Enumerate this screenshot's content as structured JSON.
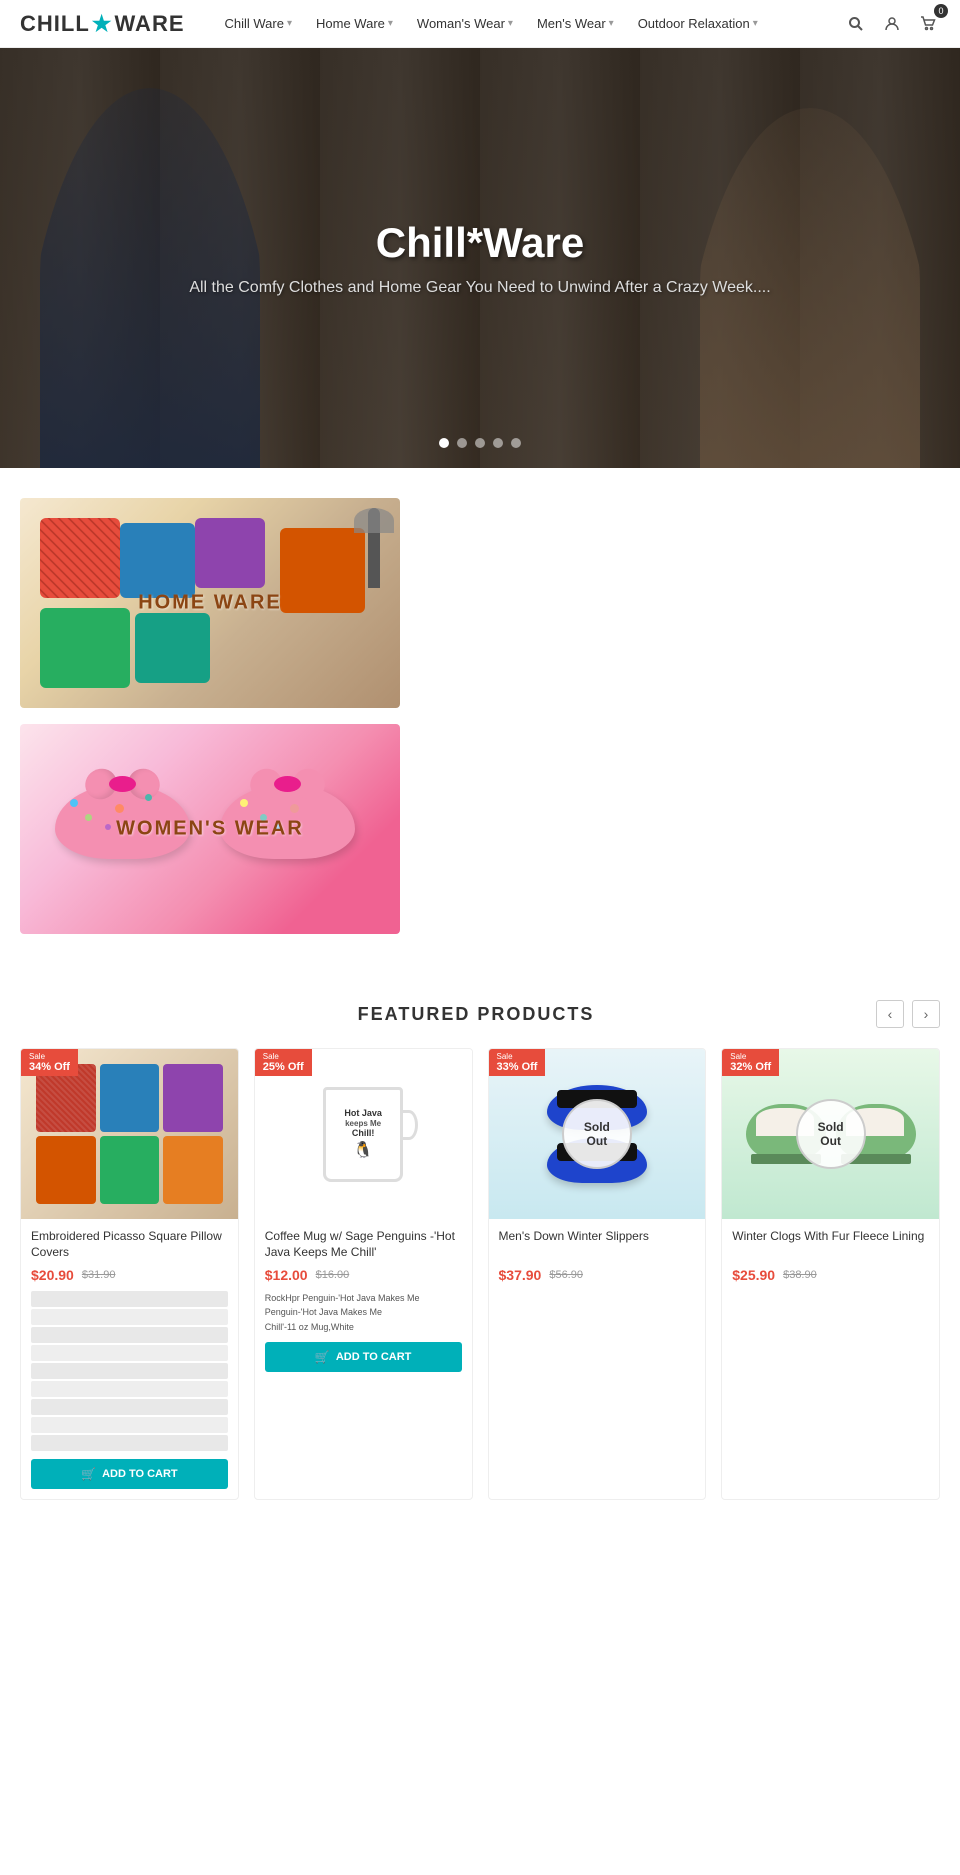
{
  "header": {
    "logo": "CHILL",
    "logo_star": "★",
    "logo_ware": "WARE",
    "nav_items": [
      {
        "label": "Chill Ware",
        "has_dropdown": true
      },
      {
        "label": "Home Ware",
        "has_dropdown": true
      },
      {
        "label": "Woman's Wear",
        "has_dropdown": true
      },
      {
        "label": "Men's Wear",
        "has_dropdown": true
      },
      {
        "label": "Outdoor Relaxation",
        "has_dropdown": true
      }
    ],
    "cart_count": "0"
  },
  "hero": {
    "title": "Chill*Ware",
    "subtitle": "All the Comfy Clothes and Home Gear You Need to Unwind After a Crazy Week....",
    "dots": [
      true,
      false,
      false,
      false,
      false
    ]
  },
  "categories": [
    {
      "label": "HOME WARE",
      "type": "homeware"
    },
    {
      "label": "WOMEN'S WEAR",
      "type": "womens"
    }
  ],
  "featured": {
    "title": "FEATURED PRODUCTS",
    "prev_label": "‹",
    "next_label": "›",
    "products": [
      {
        "id": 1,
        "name": "Embroidered Picasso Square Pillow Covers",
        "sale_text": "Sale",
        "sale_pct": "34% Off",
        "price": "$20.90",
        "original_price": "$31.90",
        "sold_out": false,
        "has_variants": true,
        "variant_count": 9,
        "btn_label": "ADD TO CART",
        "type": "pillows"
      },
      {
        "id": 2,
        "name": "Coffee Mug w/ Sage Penguins -'Hot Java Keeps Me Chill'",
        "sale_text": "Sale",
        "sale_pct": "25% Off",
        "price": "$12.00",
        "original_price": "$16.00",
        "sold_out": false,
        "has_variants": false,
        "mug_variants": [
          "RockHpr Penguin-'Hot Java Makes Me",
          "Penguin-'Hot Java Makes Me",
          "Chill'-11 oz Mug,White"
        ],
        "btn_label": "ADD TO CART",
        "type": "mug",
        "mug_text": "Hot Java keeps Me Chill!"
      },
      {
        "id": 3,
        "name": "Men's Down Winter Slippers",
        "sale_text": "Sale",
        "sale_pct": "33% Off",
        "price": "$37.90",
        "original_price": "$56.90",
        "sold_out": true,
        "type": "slippers_blue"
      },
      {
        "id": 4,
        "name": "Winter Clogs With Fur Fleece Lining",
        "sale_text": "Sale",
        "sale_pct": "32% Off",
        "price": "$25.90",
        "original_price": "$38.90",
        "sold_out": true,
        "type": "clogs_green"
      }
    ]
  },
  "icons": {
    "search": "🔍",
    "user": "👤",
    "cart": "🛒",
    "cart_small": "🛒"
  }
}
